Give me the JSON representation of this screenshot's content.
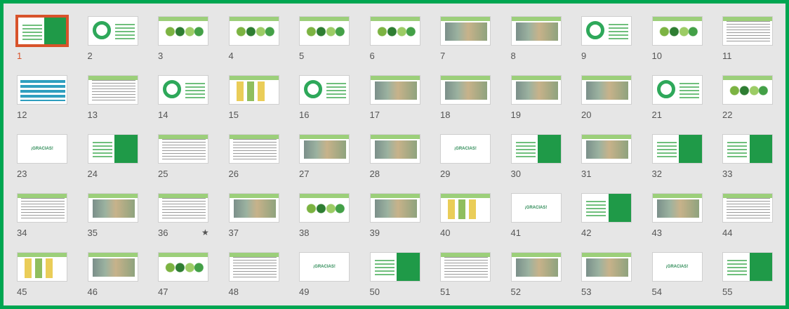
{
  "slides": [
    {
      "n": "1",
      "k": "title",
      "sel": true
    },
    {
      "n": "2",
      "k": "ring"
    },
    {
      "n": "3",
      "k": "diagram"
    },
    {
      "n": "4",
      "k": "hex"
    },
    {
      "n": "5",
      "k": "hex"
    },
    {
      "n": "6",
      "k": "hex"
    },
    {
      "n": "7",
      "k": "photo"
    },
    {
      "n": "8",
      "k": "photo"
    },
    {
      "n": "9",
      "k": "ring"
    },
    {
      "n": "10",
      "k": "diagram"
    },
    {
      "n": "11",
      "k": "text"
    },
    {
      "n": "12",
      "k": "blue"
    },
    {
      "n": "13",
      "k": "text"
    },
    {
      "n": "14",
      "k": "ring"
    },
    {
      "n": "15",
      "k": "chart"
    },
    {
      "n": "16",
      "k": "ring"
    },
    {
      "n": "17",
      "k": "photo"
    },
    {
      "n": "18",
      "k": "photo"
    },
    {
      "n": "19",
      "k": "photo"
    },
    {
      "n": "20",
      "k": "photo"
    },
    {
      "n": "21",
      "k": "ring"
    },
    {
      "n": "22",
      "k": "hex"
    },
    {
      "n": "23",
      "k": "gracias"
    },
    {
      "n": "24",
      "k": "title"
    },
    {
      "n": "25",
      "k": "text"
    },
    {
      "n": "26",
      "k": "text"
    },
    {
      "n": "27",
      "k": "photo"
    },
    {
      "n": "28",
      "k": "photo"
    },
    {
      "n": "29",
      "k": "gracias"
    },
    {
      "n": "30",
      "k": "title"
    },
    {
      "n": "31",
      "k": "photo"
    },
    {
      "n": "32",
      "k": "title"
    },
    {
      "n": "33",
      "k": "title"
    },
    {
      "n": "34",
      "k": "text"
    },
    {
      "n": "35",
      "k": "photo"
    },
    {
      "n": "36",
      "k": "text",
      "star": true
    },
    {
      "n": "37",
      "k": "photo"
    },
    {
      "n": "38",
      "k": "diagram"
    },
    {
      "n": "39",
      "k": "photo"
    },
    {
      "n": "40",
      "k": "chart"
    },
    {
      "n": "41",
      "k": "gracias"
    },
    {
      "n": "42",
      "k": "title"
    },
    {
      "n": "43",
      "k": "photo"
    },
    {
      "n": "44",
      "k": "text"
    },
    {
      "n": "45",
      "k": "chart"
    },
    {
      "n": "46",
      "k": "photo"
    },
    {
      "n": "47",
      "k": "diagram"
    },
    {
      "n": "48",
      "k": "text"
    },
    {
      "n": "49",
      "k": "gracias"
    },
    {
      "n": "50",
      "k": "title"
    },
    {
      "n": "51",
      "k": "text"
    },
    {
      "n": "52",
      "k": "photo"
    },
    {
      "n": "53",
      "k": "photo"
    },
    {
      "n": "54",
      "k": "gracias"
    },
    {
      "n": "55",
      "k": "title"
    }
  ],
  "gracias_label": "¡GRACIAS!",
  "star_glyph": "★",
  "colors": {
    "frame": "#00a651",
    "selected": "#d8532b",
    "slide_green": "#1f9a48"
  }
}
